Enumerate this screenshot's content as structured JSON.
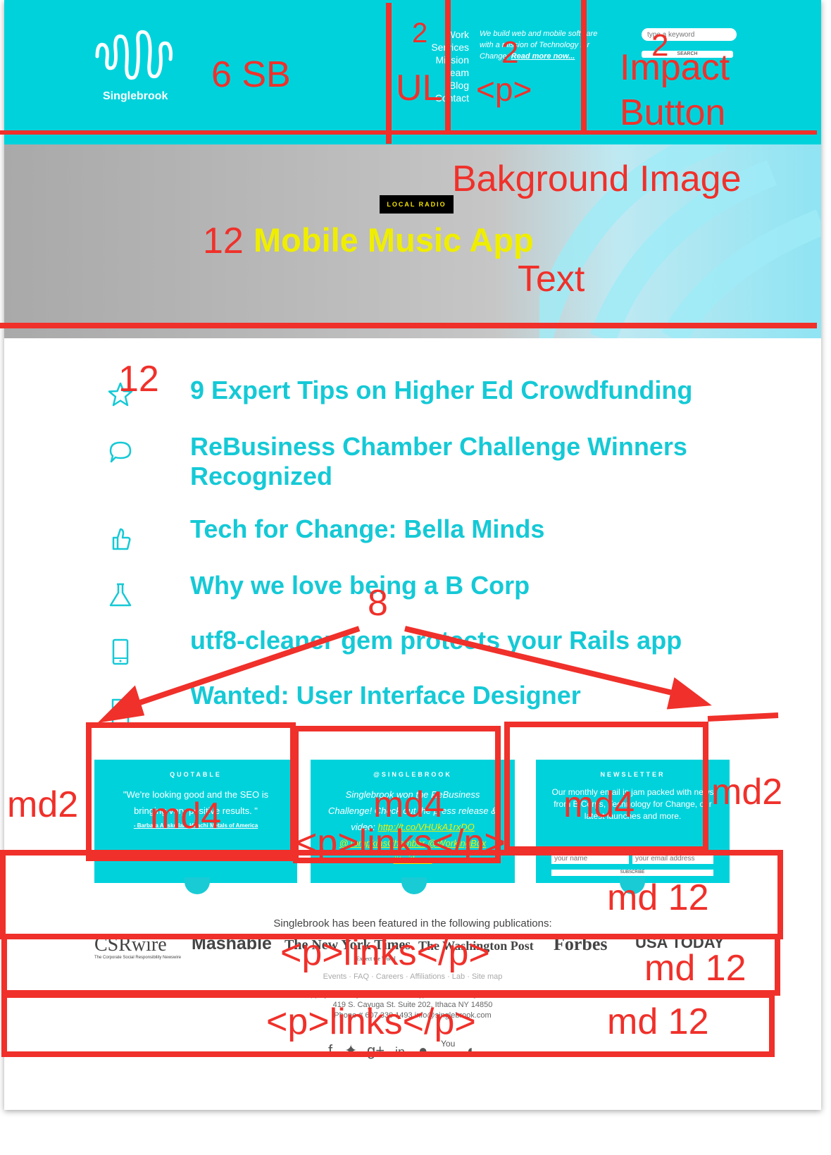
{
  "header": {
    "logo_text": "Singlebrook",
    "nav": [
      "Work",
      "Services",
      "Mission",
      "Team",
      "Blog",
      "Contact"
    ],
    "tagline": "We build web and mobile software with a mission of Technology for Change.",
    "tagline_link": "Read more now...",
    "search_placeholder": "type a keyword",
    "search_button": "SEARCH"
  },
  "hero": {
    "badge": "LOCAL RADIO",
    "title": "Mobile Music App"
  },
  "articles": [
    {
      "title": "9 Expert Tips on Higher Ed Crowdfunding",
      "icon": "star-icon"
    },
    {
      "title": "ReBusiness Chamber Challenge Winners",
      "title2": "Recognized",
      "icon": "speech-bubble-icon"
    },
    {
      "title": "Tech for Change: Bella Minds",
      "icon": "thumbs-up-icon"
    },
    {
      "title": "Why we love being a B Corp",
      "icon": "flask-icon"
    },
    {
      "title": "utf8-cleaner gem protects your Rails app",
      "icon": "phone-icon"
    },
    {
      "title": "Wanted: User Interface Designer",
      "icon": "document-icon"
    }
  ],
  "cards": {
    "quotable": {
      "title": "QUOTABLE",
      "quote": "\"We're looking good and the SEO is bringing very positive results. \"",
      "attribution": "- Barbara Anskellan, Hitachi Metals of America"
    },
    "twitter": {
      "title": "@SINGLEBROOK",
      "text": "Singlebrook won the ReBusiness Challenge! Check out the press release & video:",
      "link1": "http://t.co/VHUkA1rxDO",
      "link2": "@TompkinsChamber",
      "link3": "@WorkingBox",
      "link4": "#twithaca"
    },
    "newsletter": {
      "title": "NEWSLETTER",
      "text": "Our monthly email is jam packed with news from B Corps, Technology for Change, our latest launches and more.",
      "name_placeholder": "your name",
      "email_placeholder": "your email address",
      "button": "SUBSCRIBE"
    }
  },
  "featured": {
    "text": "Singlebrook has been featured in the following publications:",
    "publications": [
      "CSRwire",
      "Mashable",
      "The New York Times",
      "The Washington Post",
      "Forbes",
      "USA TODAY"
    ],
    "csr_sub": "The Corporate Social Responsibility Newswire",
    "nyt_sub": "Expect the World"
  },
  "footer": {
    "links": "Events · FAQ · Careers · Affiliations · Lab · Site map",
    "copyright": "Copyright © Singlebrook Technology Inc. Some Rights Reserved.",
    "address": "419 S. Cayuga St. Suite 202, Ithaca NY 14850",
    "phone": "Phone # 607 330 1493 info@singlebrook.com",
    "social": [
      "facebook-icon",
      "twitter-icon",
      "google-plus-icon",
      "linkedin-icon",
      "github-icon",
      "youtube-icon",
      "rss-icon"
    ]
  },
  "annotations": {
    "a1": "6   SB",
    "a2": "2",
    "a3": "UL",
    "a4": "2",
    "a5": "<p>",
    "a6": "2",
    "a7": "Impact",
    "a8": "Button",
    "a9": "Bakground Image",
    "a10": "12",
    "a11": "Text",
    "a12": "12",
    "a13": "8",
    "a14": "md2",
    "a15": "md4",
    "a16": "md4",
    "a17": "md4",
    "a18": "md2",
    "a19": "<p>links</p>",
    "a20": "md 12",
    "a21": "<p>links</p>",
    "a22": "md 12",
    "a23": "<p>links</p>",
    "a24": "md 12"
  },
  "colors": {
    "brand_cyan": "#00d2dc",
    "headline_teal": "#15c9d6",
    "hero_yellow": "#f0ee00",
    "annotation_red": "#f0302a"
  }
}
